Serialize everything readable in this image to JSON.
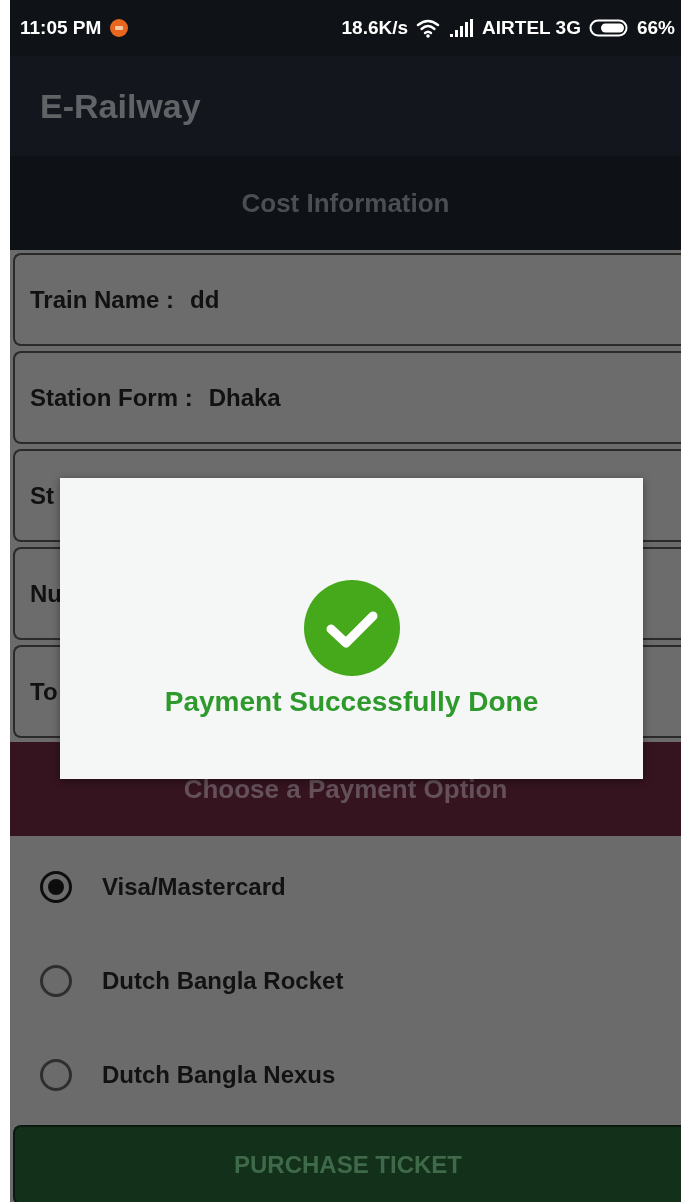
{
  "status_bar": {
    "time": "11:05 PM",
    "speed": "18.6K/s",
    "carrier": "AIRTEL 3G",
    "battery": "66%"
  },
  "app_bar": {
    "title": "E-Railway"
  },
  "cost_section": {
    "heading": "Cost Information"
  },
  "fields": [
    {
      "label": "Train Name :",
      "value": "dd"
    },
    {
      "label": "Station Form :",
      "value": "Dhaka"
    },
    {
      "label": "St"
    },
    {
      "label": "Nu"
    },
    {
      "label": "To"
    }
  ],
  "payment_section": {
    "heading": "Choose a Payment Option"
  },
  "payment_options": [
    {
      "label": "Visa/Mastercard",
      "selected": true
    },
    {
      "label": "Dutch Bangla Rocket",
      "selected": false
    },
    {
      "label": "Dutch Bangla Nexus",
      "selected": false
    }
  ],
  "purchase_button": {
    "label": "PURCHASE TICKET"
  },
  "dialog": {
    "message": "Payment Successfully Done"
  }
}
